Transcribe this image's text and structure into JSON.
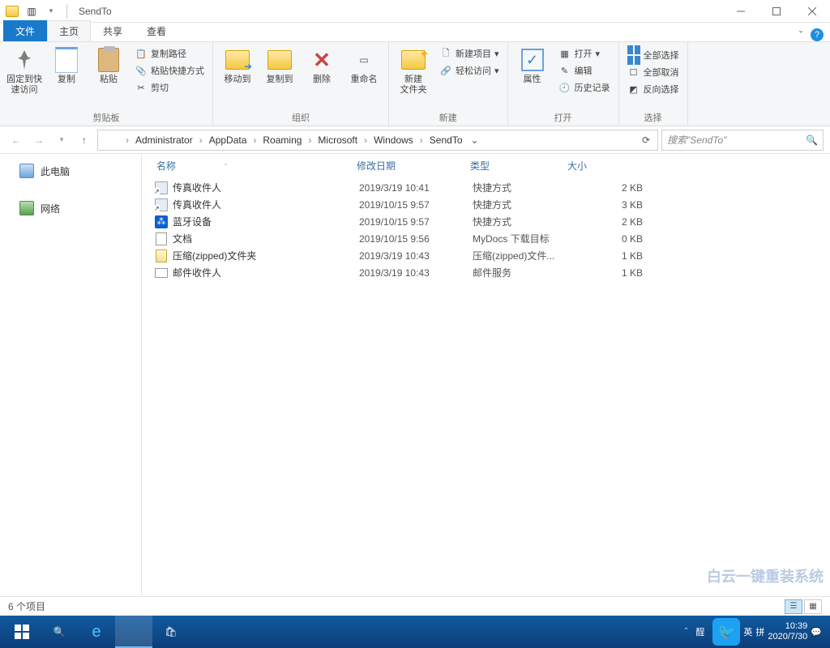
{
  "window": {
    "title": "SendTo"
  },
  "tabs": {
    "file": "文件",
    "home": "主页",
    "share": "共享",
    "view": "查看"
  },
  "ribbon": {
    "clipboard": {
      "pin": "固定到快\n速访问",
      "copy": "复制",
      "paste": "粘贴",
      "copy_path": "复制路径",
      "paste_shortcut": "粘贴快捷方式",
      "cut": "剪切",
      "label": "剪贴板"
    },
    "organize": {
      "move_to": "移动到",
      "copy_to": "复制到",
      "delete": "删除",
      "rename": "重命名",
      "label": "组织"
    },
    "new": {
      "new_folder": "新建\n文件夹",
      "new_item": "新建项目",
      "easy_access": "轻松访问",
      "label": "新建"
    },
    "open": {
      "properties": "属性",
      "open": "打开",
      "edit": "编辑",
      "history": "历史记录",
      "label": "打开"
    },
    "select": {
      "select_all": "全部选择",
      "select_none": "全部取消",
      "invert": "反向选择",
      "label": "选择"
    }
  },
  "breadcrumb": [
    "Administrator",
    "AppData",
    "Roaming",
    "Microsoft",
    "Windows",
    "SendTo"
  ],
  "search": {
    "placeholder": "搜索\"SendTo\""
  },
  "sidebar": {
    "this_pc": "此电脑",
    "network": "网络"
  },
  "columns": {
    "name": "名称",
    "date": "修改日期",
    "type": "类型",
    "size": "大小"
  },
  "files": [
    {
      "name": "传真收件人",
      "date": "2019/3/19 10:41",
      "type": "快捷方式",
      "size": "2 KB",
      "icon": "shortcut"
    },
    {
      "name": "传真收件人",
      "date": "2019/10/15 9:57",
      "type": "快捷方式",
      "size": "3 KB",
      "icon": "shortcut"
    },
    {
      "name": "蓝牙设备",
      "date": "2019/10/15 9:57",
      "type": "快捷方式",
      "size": "2 KB",
      "icon": "bluetooth"
    },
    {
      "name": "文档",
      "date": "2019/10/15 9:56",
      "type": "MyDocs 下载目标",
      "size": "0 KB",
      "icon": "doc"
    },
    {
      "name": "压缩(zipped)文件夹",
      "date": "2019/3/19 10:43",
      "type": "压缩(zipped)文件...",
      "size": "1 KB",
      "icon": "zip"
    },
    {
      "name": "邮件收件人",
      "date": "2019/3/19 10:43",
      "type": "邮件服务",
      "size": "1 KB",
      "icon": "mail"
    }
  ],
  "status": {
    "count": "6 个项目"
  },
  "taskbar": {
    "time": "10:39",
    "date": "2020/7/30"
  },
  "watermark": "白云一键重装系统"
}
